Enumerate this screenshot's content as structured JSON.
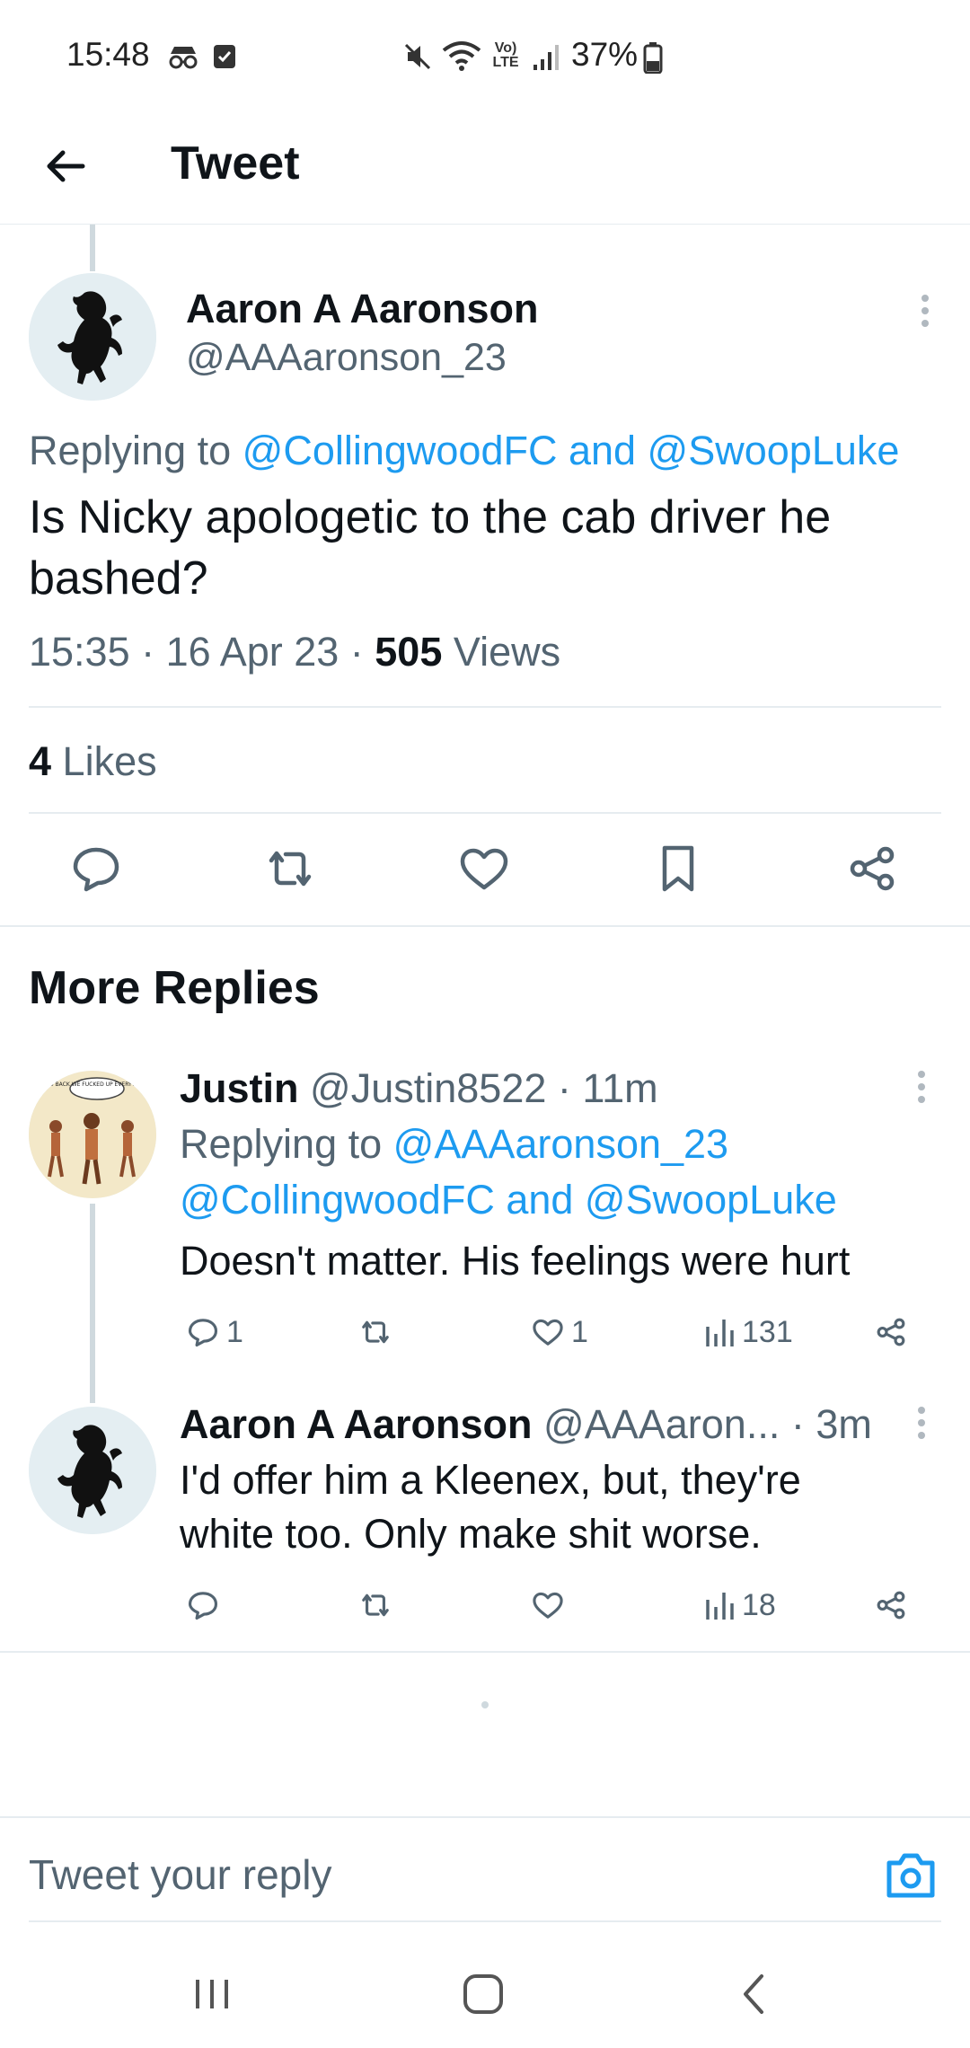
{
  "status_bar": {
    "time": "15:48",
    "battery": "37%",
    "network": "Vo) LTE"
  },
  "header": {
    "title": "Tweet",
    "back_icon": "arrow-left-icon"
  },
  "main_tweet": {
    "author_name": "Aaron A Aaronson",
    "author_handle": "@AAAaronson_23",
    "replying_prefix": "Replying to",
    "replying_targets": "@CollingwoodFC and @SwoopLuke",
    "text": "Is Nicky apologetic to the cab driver he bashed?",
    "time": "15:35",
    "date": "16 Apr 23",
    "views_count": "505",
    "views_label": "Views",
    "likes_count": "4",
    "likes_label": "Likes"
  },
  "more_replies": {
    "title": "More Replies"
  },
  "replies": [
    {
      "author_name": "Justin",
      "author_handle": "@Justin8522",
      "time": "· 11m",
      "replying_prefix": "Replying to",
      "replying_line1": "@AAAaronson_23",
      "replying_line2": "@CollingwoodFC and @SwoopLuke",
      "avatar_text": "GO BACK WE FUCKED UP EVERYTHING",
      "text": "Doesn't matter. His feelings were hurt",
      "reply_count": "1",
      "like_count": "1",
      "view_count": "131"
    },
    {
      "author_name": "Aaron A Aaronson",
      "author_handle": "@AAAaron...",
      "time": "· 3m",
      "text_line1": "I'd offer him a Kleenex, but, they're",
      "text_line2": "white too. Only make shit worse.",
      "view_count": "18"
    }
  ],
  "composer": {
    "placeholder": "Tweet your reply",
    "camera_icon": "camera-icon"
  },
  "colors": {
    "accent": "#1d9bf0",
    "text": "#0f1419",
    "muted": "#536471",
    "divider": "#e6ecf0"
  }
}
